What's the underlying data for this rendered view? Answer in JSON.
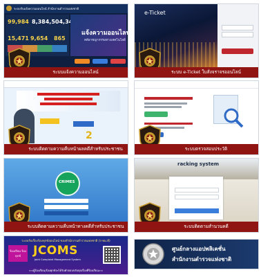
{
  "tiles": {
    "t1": {
      "header": "ระบบรับแจ้งความออนไลน์ สำนักงานตำรวจแห่งชาติ",
      "stats": [
        {
          "value": "99,984",
          "color": "#f7d34a"
        },
        {
          "value": "8,384,504,345",
          "color": "#ffffff"
        },
        {
          "value": "15,471",
          "color": "#f7d34a"
        },
        {
          "value": "9,654",
          "color": "#f7d34a"
        },
        {
          "value": "865",
          "color": "#f7d34a"
        }
      ],
      "banner_title": "แจ้งความออนไลน์",
      "banner_sub": "คดีอาชญากรรมทางเทคโนโลยี",
      "caption": "ระบบแจ้งความออนไลน์"
    },
    "t2": {
      "title": "e-Ticket",
      "caption": "ระบบ e-Ticket ใบสั่งจราจรออนไลน์"
    },
    "t3": {
      "caption": "ระบบติดตามความคืบหน้าผลคดีสำหรับประชาชน"
    },
    "t4": {
      "caption": "ระบบตรวจสอบประวัติ"
    },
    "t5": {
      "badge": "CRIMES",
      "caption": "ระบบติดตามความคืบหน้าทางคดีสำหรับประชาชน"
    },
    "t6": {
      "title": "racking system",
      "caption": "ระบบติดตามสำนวนคดี"
    },
    "t7": {
      "line1": "ระบบรับเรื่องร้องทุกข์ออนไลน์ ของสำนักงานตำรวจแห่งชาติ (ร-ทม.ดี)",
      "brand": "JCOMS",
      "brand_sub": "Joint Complaint Management System",
      "side": "ร้องเรียน ร้องทุกข์",
      "footer": "<<ผู้ร้องเรียน/ร้องทุกข์จะได้รับคำตอบกลับทุกเรื่องที่ร้องเรียน>>"
    },
    "t8": {
      "line1": "ศูนย์กลางแอปพลิเคชั่น",
      "line2": "สำนักงานตำรวจแห่งชาติ"
    }
  }
}
